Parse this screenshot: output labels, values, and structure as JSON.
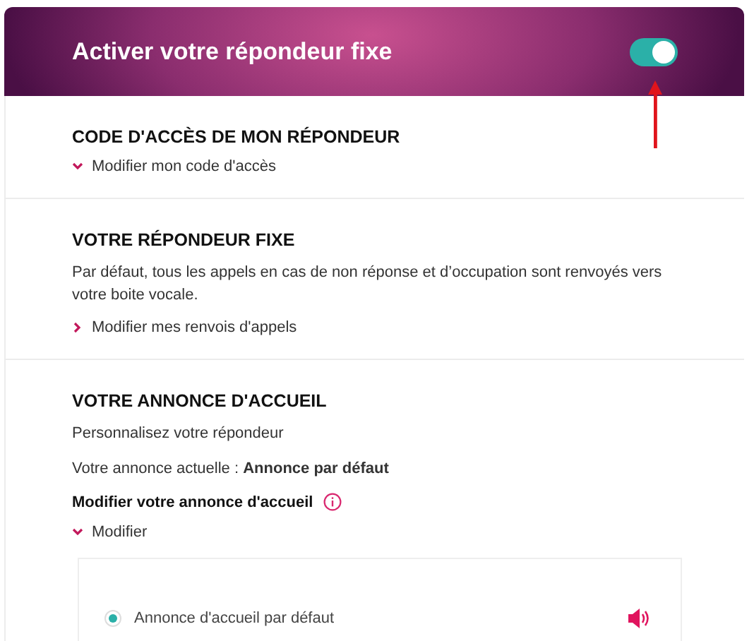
{
  "header": {
    "title": "Activer votre répondeur fixe",
    "toggle": {
      "on": true
    }
  },
  "sections": [
    {
      "heading": "CODE D'ACCÈS DE MON RÉPONDEUR",
      "items": [
        {
          "kind": "link",
          "text": "Modifier mon code d'accès",
          "expanded": true
        }
      ]
    },
    {
      "heading": "VOTRE RÉPONDEUR FIXE",
      "items": [
        {
          "kind": "text",
          "text": "Par défaut, tous les appels en cas de non réponse et d’occupation sont renvoyés vers votre boite vocale."
        },
        {
          "kind": "link",
          "text": "Modifier mes renvois d'appels",
          "expanded": false
        }
      ]
    },
    {
      "heading": "VOTRE ANNONCE D'ACCUEIL",
      "items": [
        {
          "kind": "text",
          "text": "Personnalisez votre répondeur"
        },
        {
          "kind": "text",
          "text": "Votre annonce actuelle : **Annonce par défaut**"
        },
        {
          "kind": "label",
          "text": "**Modifier votre annonce d'accueil**"
        },
        {
          "kind": "link",
          "text": "Modifier",
          "expanded": true
        },
        {
          "kind": "options",
          "options": [
            {
              "label": "Annonce d'accueil par défaut",
              "selected": true
            }
          ]
        }
      ]
    }
  ]
}
